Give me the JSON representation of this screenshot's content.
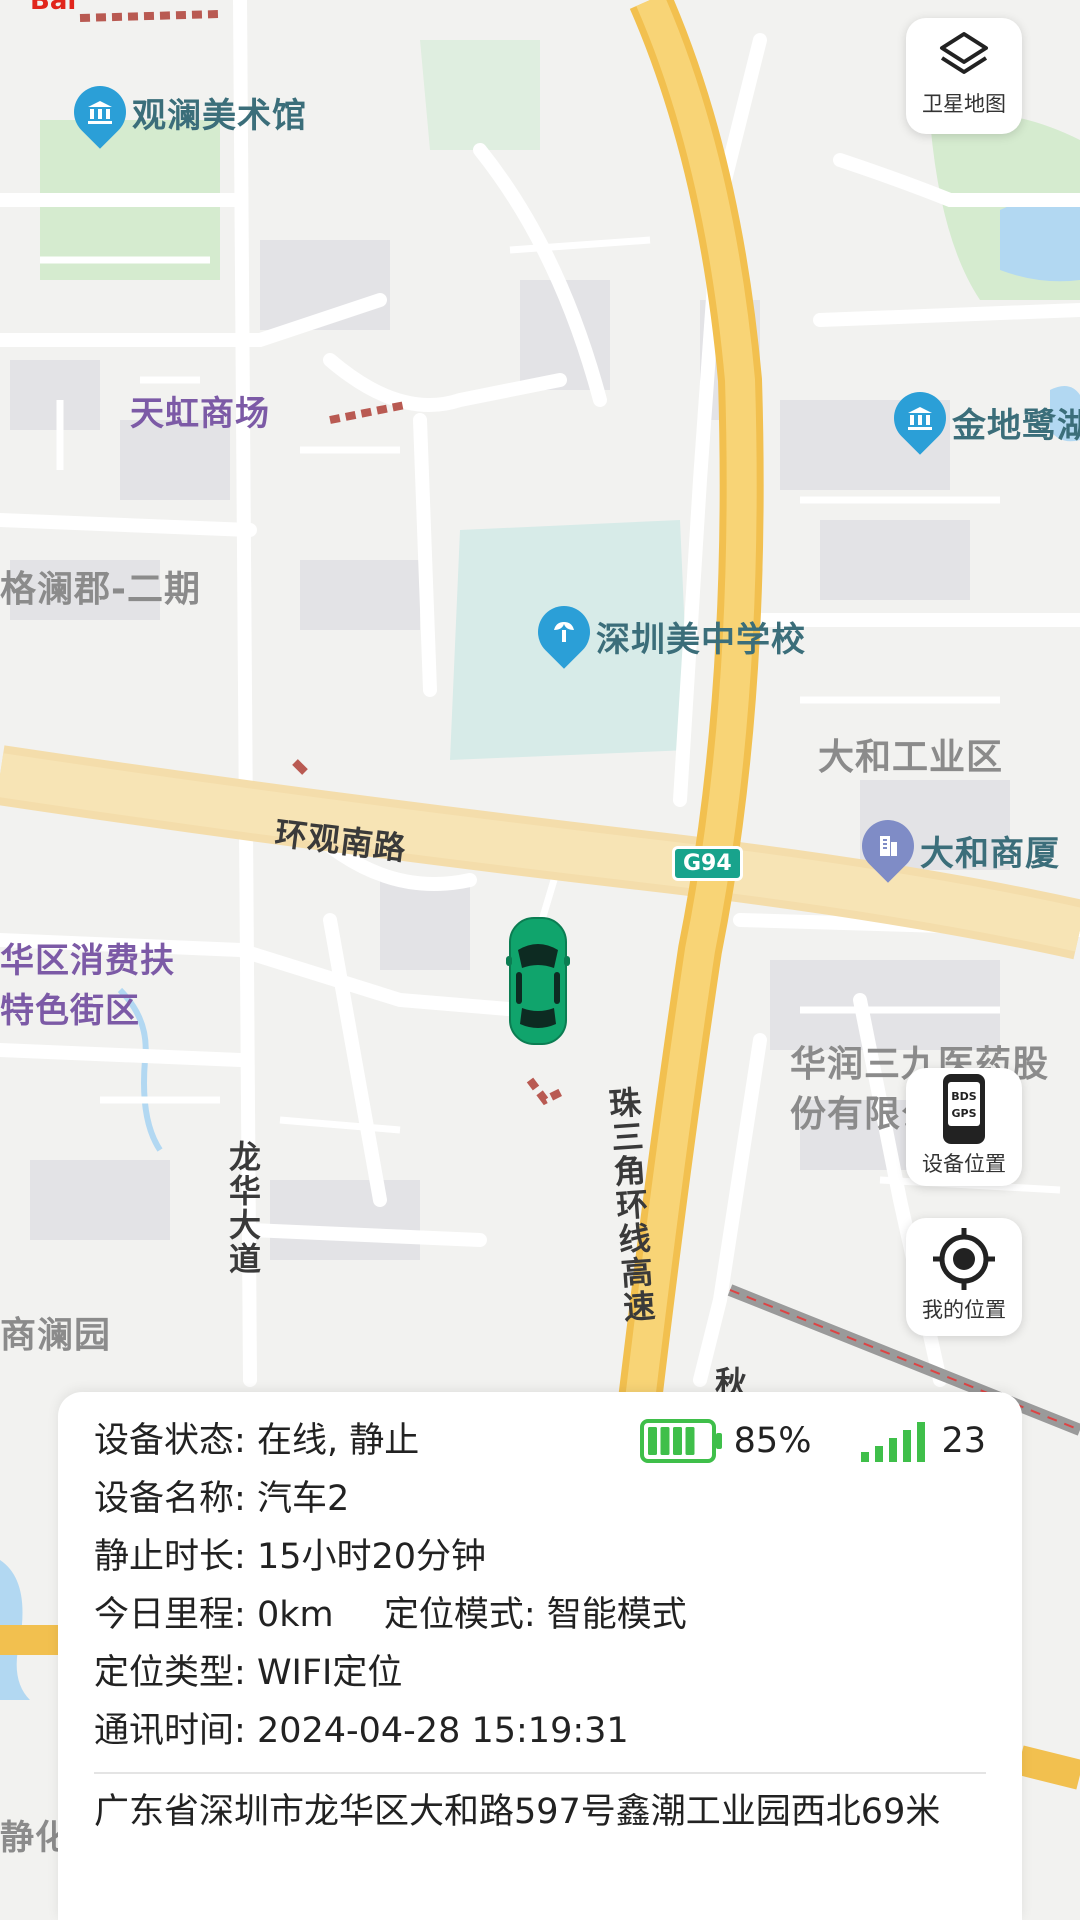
{
  "map": {
    "logo": "Bai",
    "poi": {
      "guanlan_art_museum": "观澜美术馆",
      "tianhong_mall": "天虹商场",
      "gelanjun_phase2": "格澜郡-二期",
      "shenzhen_meizhong_school": "深圳美中学校",
      "dahe_industrial_zone": "大和工业区",
      "dahe_building": "大和商厦",
      "jindi_egret": "金地鹭湖",
      "huarun_sanjiu": "华润三九医药股份有限公司",
      "shanglan_garden": "商澜园",
      "longhua_consumption_street": "华区消费扶特色街区",
      "jinghua": "静化"
    },
    "roads": {
      "huanguan_south_road": "环观南路",
      "longhua_avenue": "龙华大道",
      "prd_ring_expressway": "珠三角环线高速",
      "g94": "G94",
      "partial_road": "秋"
    },
    "colors": {
      "background": "#f2f2f0",
      "road_major": "#f7c85a",
      "road_minor": "#ffffff",
      "green": "#d5ebcf",
      "water": "#b2d8f2",
      "car": "#10a46c"
    }
  },
  "controls": {
    "satellite_map": {
      "label": "卫星地图",
      "icon": "layers-icon"
    },
    "device_location": {
      "label": "设备位置",
      "icon": "bds-gps-device-icon",
      "icon_text_1": "BDS",
      "icon_text_2": "GPS"
    },
    "my_location": {
      "label": "我的位置",
      "icon": "crosshair-icon"
    }
  },
  "info": {
    "status_label": "设备状态:",
    "status_value": "在线, 静止",
    "battery_percent": "85%",
    "battery_level": 0.85,
    "signal_value": "23",
    "name_label": "设备名称:",
    "name_value": "汽车2",
    "still_label": "静止时长:",
    "still_value": "15小时20分钟",
    "mileage_label": "今日里程:",
    "mileage_value": "0km",
    "mode_label": "定位模式:",
    "mode_value": "智能模式",
    "loc_type_label": "定位类型:",
    "loc_type_value": "WIFI定位",
    "comm_time_label": "通讯时间:",
    "comm_time_value": "2024-04-28 15:19:31",
    "address": "广东省深圳市龙华区大和路597号鑫潮工业园西北69米",
    "colors": {
      "battery": "#3fbf4a",
      "signal": "#3fbf4a"
    }
  }
}
